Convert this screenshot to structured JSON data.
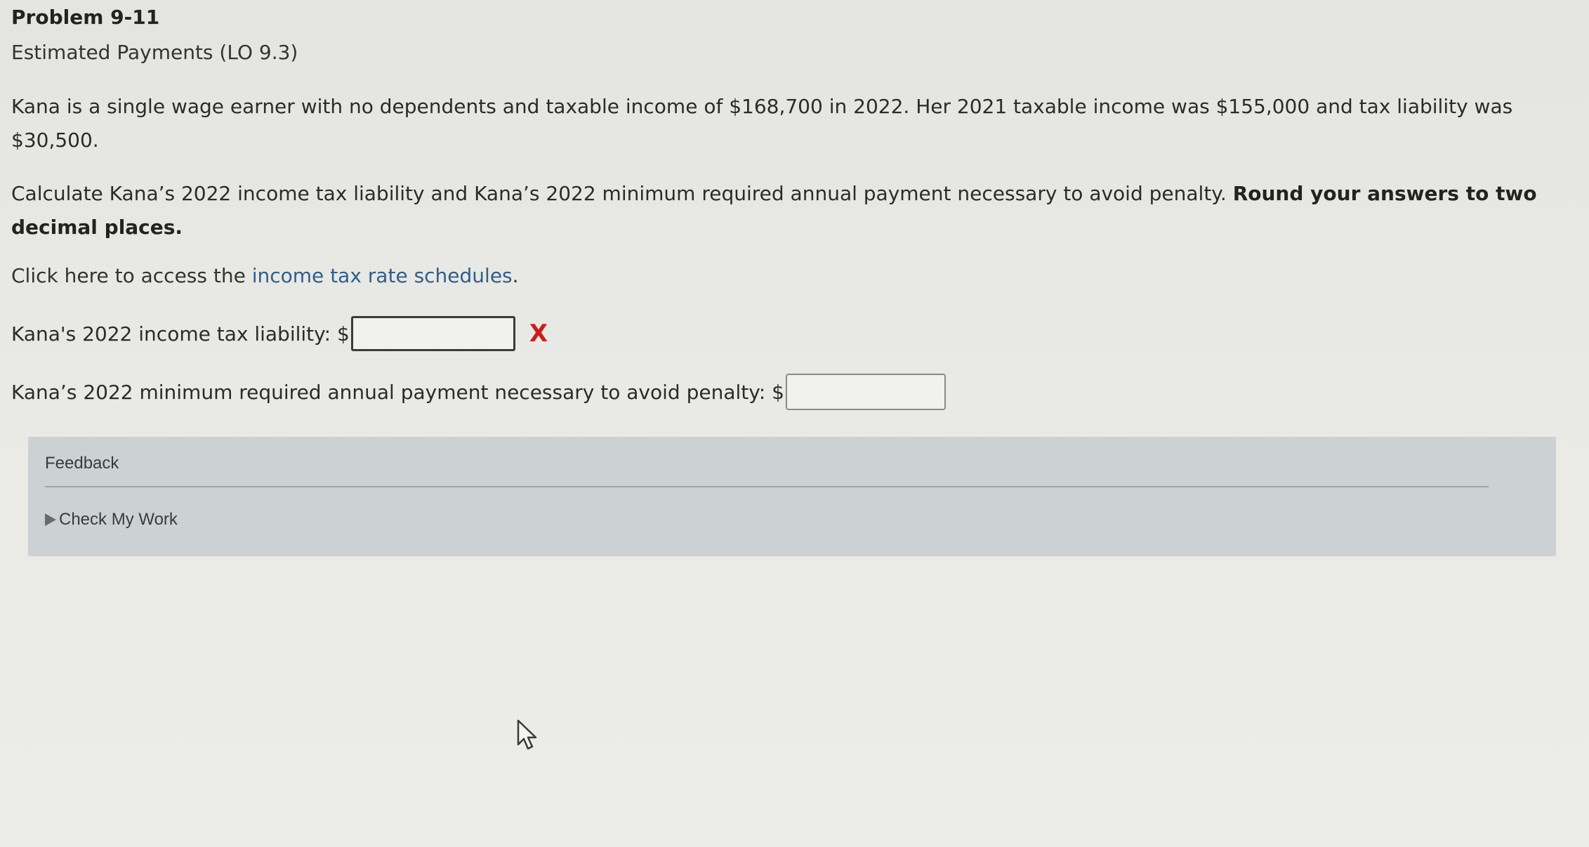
{
  "problem": {
    "title": "Problem 9-11",
    "subtitle": "Estimated Payments (LO 9.3)"
  },
  "scenario": {
    "text": "Kana is a single wage earner with no dependents and taxable income of $168,700 in 2022. Her 2021 taxable income was $155,000 and tax liability was $30,500."
  },
  "instructions": {
    "text": "Calculate Kana’s 2022 income tax liability and Kana’s 2022 minimum required annual payment necessary to avoid penalty.",
    "bold_text": "Round your answers to two decimal places."
  },
  "resource": {
    "prefix": "Click here to access the ",
    "link_text": "income tax rate schedules",
    "suffix": "."
  },
  "questions": [
    {
      "label": "Kana's 2022 income tax liability: $",
      "value": "",
      "status_mark": "X"
    },
    {
      "label": "Kana’s 2022 minimum required annual payment necessary to avoid penalty: $",
      "value": ""
    }
  ],
  "feedback": {
    "title": "Feedback",
    "check_label": "Check My Work"
  },
  "colors": {
    "link": "#2f5f8a",
    "error": "#cc1d1d",
    "feedback_bg": "#ccd1d3"
  }
}
